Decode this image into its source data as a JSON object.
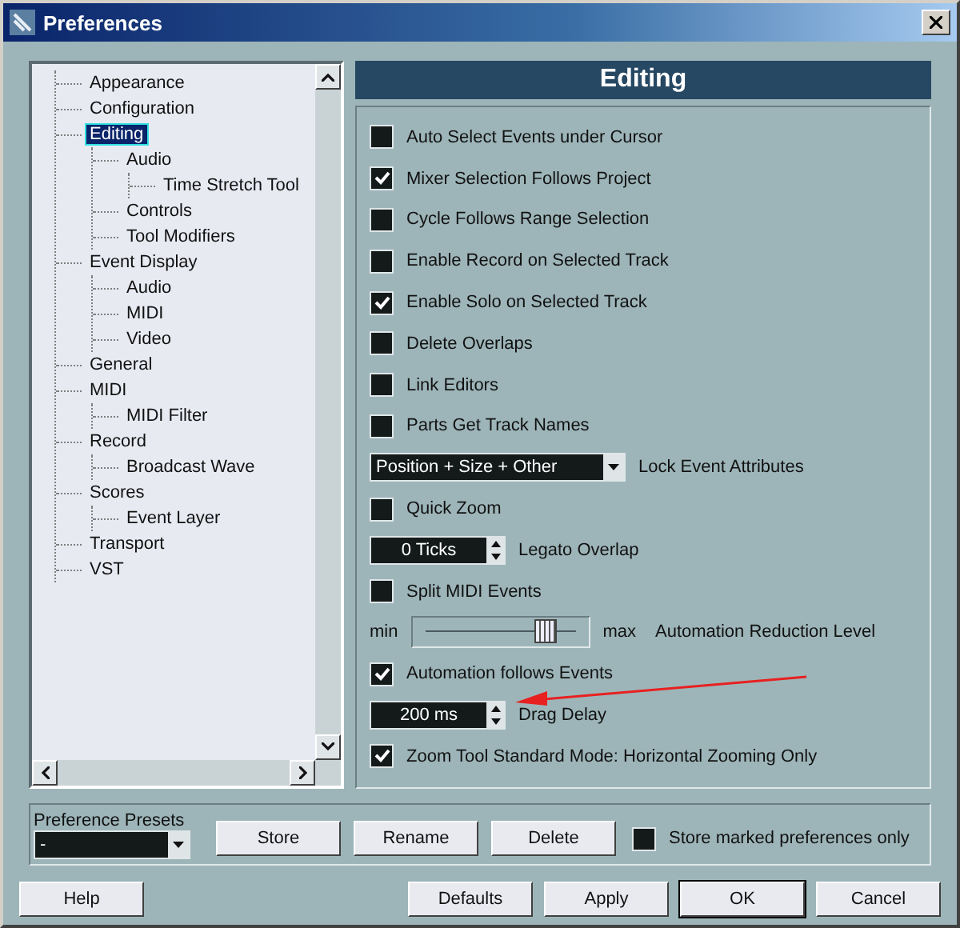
{
  "window": {
    "title": "Preferences"
  },
  "tree": [
    {
      "label": "Appearance",
      "selected": false
    },
    {
      "label": "Configuration",
      "selected": false
    },
    {
      "label": "Editing",
      "selected": true,
      "children": [
        {
          "label": "Audio",
          "selected": false,
          "children": [
            {
              "label": "Time Stretch Tool",
              "selected": false
            }
          ]
        },
        {
          "label": "Controls",
          "selected": false
        },
        {
          "label": "Tool Modifiers",
          "selected": false
        }
      ]
    },
    {
      "label": "Event Display",
      "selected": false,
      "children": [
        {
          "label": "Audio",
          "selected": false
        },
        {
          "label": "MIDI",
          "selected": false
        },
        {
          "label": "Video",
          "selected": false
        }
      ]
    },
    {
      "label": "General",
      "selected": false
    },
    {
      "label": "MIDI",
      "selected": false,
      "children": [
        {
          "label": "MIDI Filter",
          "selected": false
        }
      ]
    },
    {
      "label": "Record",
      "selected": false,
      "children": [
        {
          "label": "Broadcast Wave",
          "selected": false
        }
      ]
    },
    {
      "label": "Scores",
      "selected": false,
      "children": [
        {
          "label": "Event Layer",
          "selected": false
        }
      ]
    },
    {
      "label": "Transport",
      "selected": false
    },
    {
      "label": "VST",
      "selected": false
    }
  ],
  "panel": {
    "title": "Editing",
    "items": [
      {
        "kind": "checkbox",
        "label": "Auto Select Events under Cursor",
        "checked": false
      },
      {
        "kind": "checkbox",
        "label": "Mixer Selection Follows Project",
        "checked": true
      },
      {
        "kind": "checkbox",
        "label": "Cycle Follows Range Selection",
        "checked": false
      },
      {
        "kind": "checkbox",
        "label": "Enable Record on Selected Track",
        "checked": false
      },
      {
        "kind": "checkbox",
        "label": "Enable Solo on Selected Track",
        "checked": true
      },
      {
        "kind": "checkbox",
        "label": "Delete Overlaps",
        "checked": false
      },
      {
        "kind": "checkbox",
        "label": "Link Editors",
        "checked": false
      },
      {
        "kind": "checkbox",
        "label": "Parts Get Track Names",
        "checked": false
      },
      {
        "kind": "dropdown",
        "value": "Position + Size + Other",
        "caption": "Lock Event Attributes"
      },
      {
        "kind": "checkbox",
        "label": "Quick Zoom",
        "checked": false
      },
      {
        "kind": "spinner",
        "value": "0 Ticks",
        "caption": "Legato Overlap"
      },
      {
        "kind": "checkbox",
        "label": "Split MIDI Events",
        "checked": false
      },
      {
        "kind": "slider",
        "min": "min",
        "max": "max",
        "level": 0.8,
        "label": "Automation Reduction Level"
      },
      {
        "kind": "checkbox",
        "label": "Automation follows Events",
        "checked": true
      },
      {
        "kind": "spinner",
        "value": "200 ms",
        "caption": "Drag Delay"
      },
      {
        "kind": "checkbox",
        "label": "Zoom Tool Standard Mode: Horizontal Zooming Only",
        "checked": true
      }
    ]
  },
  "presets": {
    "label": "Preference Presets",
    "value": "-",
    "buttons": [
      "Store",
      "Rename",
      "Delete"
    ],
    "store_marked": {
      "label": "Store marked preferences only",
      "checked": false
    }
  },
  "buttons": [
    {
      "label": "Help",
      "default": false
    },
    {
      "label": "Defaults",
      "default": false
    },
    {
      "label": "Apply",
      "default": false
    },
    {
      "label": "OK",
      "default": true
    },
    {
      "label": "Cancel",
      "default": false
    }
  ]
}
